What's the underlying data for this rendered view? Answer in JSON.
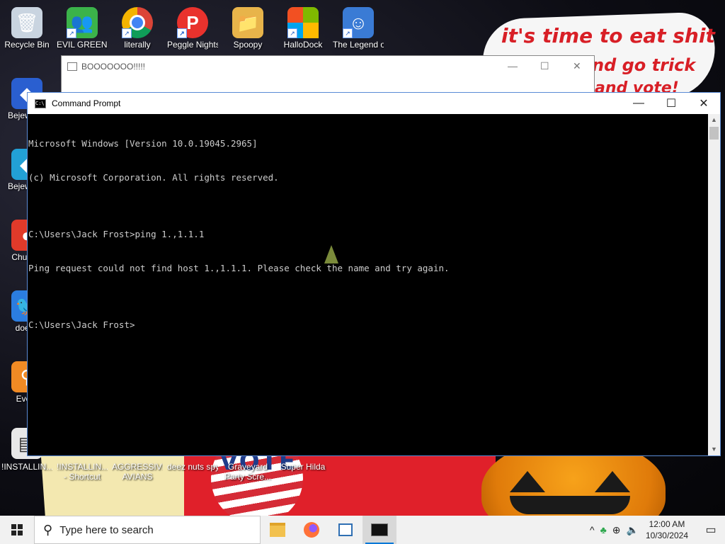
{
  "desktop": {
    "bubble_lines": [
      "it's time to eat shit",
      "nd go trick",
      "and vote!"
    ],
    "poster_text": "VOTE",
    "icons_top": [
      {
        "label": "Recycle Bin",
        "icon": "recycle-bin-icon",
        "glyph": "🗑"
      },
      {
        "label": "EVIL GREEN MEN CO",
        "icon": "green-men-icon",
        "glyph": "👥"
      },
      {
        "label": "literally",
        "icon": "chrome-icon",
        "glyph": "◉"
      },
      {
        "label": "Peggle Nights Del",
        "icon": "peggle-icon",
        "glyph": "P"
      },
      {
        "label": "Spoopy",
        "icon": "folder-icon",
        "glyph": "📁"
      },
      {
        "label": "HalloDock",
        "icon": "windows-logo-icon",
        "glyph": "⊞"
      },
      {
        "label": "The Legend of Tilda",
        "icon": "legend-icon",
        "glyph": "☺"
      }
    ],
    "icons_left": [
      {
        "label": "Bejew Del",
        "icon": "bejeweled-icon",
        "glyph": "◆"
      },
      {
        "label": "Bejew Del",
        "icon": "bejeweled-2-icon",
        "glyph": "◆"
      },
      {
        "label": "Chu Del",
        "icon": "chuzzle-icon",
        "glyph": "●"
      },
      {
        "label": "doesn",
        "icon": "bird-icon",
        "glyph": "🐦"
      },
      {
        "label": "Every",
        "icon": "everything-icon",
        "glyph": "⚲"
      },
      {
        "label": "",
        "icon": "installer-icon",
        "glyph": "▤"
      }
    ],
    "icons_bottom": [
      {
        "label": "!INSTALLIN...",
        "icon": "installer-doc-icon"
      },
      {
        "label": "!INSTALLIN... - Shortcut",
        "icon": "installer-shortcut-icon"
      },
      {
        "label": "AGGRESSIVE AVIANS",
        "icon": "avians-icon"
      },
      {
        "label": "deez nuts spy",
        "icon": "spy-icon"
      },
      {
        "label": "Graveyard Party Scre...",
        "icon": "graveyard-icon"
      },
      {
        "label": "Super Hilda",
        "icon": "hilda-icon"
      }
    ]
  },
  "back_window": {
    "title": "BOOOOOOO!!!!!",
    "minimize": "—",
    "maximize": "☐",
    "close": "✕"
  },
  "cmd_window": {
    "title": "Command Prompt",
    "minimize": "—",
    "maximize": "☐",
    "close": "✕",
    "lines": [
      "Microsoft Windows [Version 10.0.19045.2965]",
      "(c) Microsoft Corporation. All rights reserved.",
      "",
      "C:\\Users\\Jack Frost>ping 1.,1.1.1",
      "Ping request could not find host 1.,1.1.1. Please check the name and try again.",
      "",
      "C:\\Users\\Jack Frost>"
    ]
  },
  "taskbar": {
    "search_placeholder": "Type here to search",
    "apps": [
      {
        "name": "file-explorer-icon",
        "glyph": "📁",
        "active": false
      },
      {
        "name": "firefox-icon",
        "glyph": "🦊",
        "active": false
      },
      {
        "name": "window-app-icon",
        "glyph": "▣",
        "active": false
      },
      {
        "name": "cmd-icon",
        "glyph": "▮",
        "active": true
      }
    ],
    "time": "12:00 AM",
    "date": "10/30/2024",
    "tray_icons": [
      "chevron-up-icon",
      "people-icon",
      "network-icon",
      "volume-icon"
    ]
  }
}
